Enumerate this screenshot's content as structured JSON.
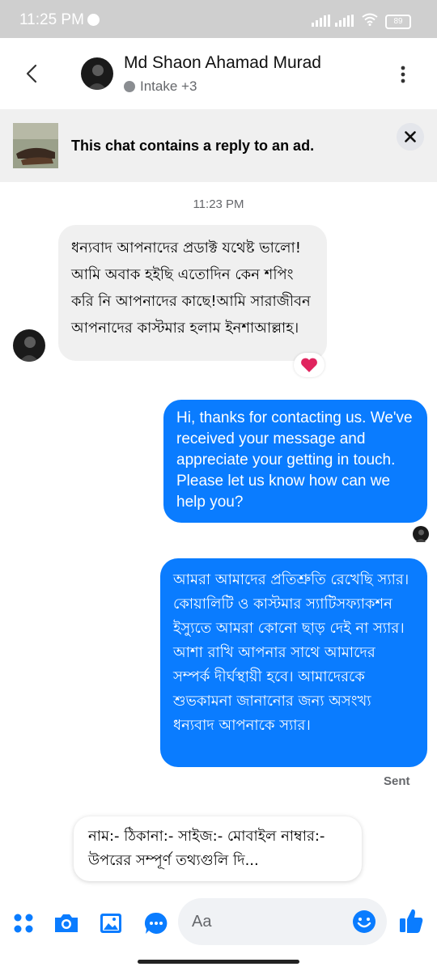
{
  "status_bar": {
    "time": "11:25 PM",
    "battery": "89"
  },
  "header": {
    "contact_name": "Md Shaon Ahamad Murad",
    "label_subtitle": "Intake +3"
  },
  "ad_banner": {
    "text": "This chat contains a reply to an ad."
  },
  "conversation": {
    "timestamp": "11:23 PM",
    "incoming_message": "ধন্যবাদ আপনাদের প্রডাক্ট যথেষ্ট ভালো!আমি অবাক হইছি এতোদিন কেন শপিং করি নি আপনাদের কাছে!আমি সারাজীবন আপনাদের কাস্টমার হলাম ইনশাআল্লাহ।",
    "incoming_reaction": "heart",
    "outgoing_message_1": "Hi, thanks for contacting us. We've received your message and appreciate your getting in touch. Please let us know how can we help you?",
    "outgoing_message_2": "আমরা আমাদের প্রতিশ্রুতি রেখেছি স্যার। কোয়ালিটি ও কাস্টমার স্যাটিসফ্যাকশন ইস্যুতে আমরা কোনো ছাড় দেই না স্যার। আশা রাখি আপনার সাথে আমাদের সম্পর্ক দীর্ঘস্থায়ী হবে। আমাদেরকে শুভকামনা জানানোর জন্য অসংখ্য ধন্যবাদ আপনাকে স্যার।",
    "delivery_status": "Sent"
  },
  "quick_reply": {
    "text": "নাম:- ঠিকানা:- সাইজ:- মোবাইল নাম্বার:- উপরের সম্পূর্ণ তথ্যগুলি দি..."
  },
  "composer": {
    "placeholder": "Aa"
  },
  "colors": {
    "accent": "#0a7cff",
    "icon_blue": "#0a7cff"
  }
}
